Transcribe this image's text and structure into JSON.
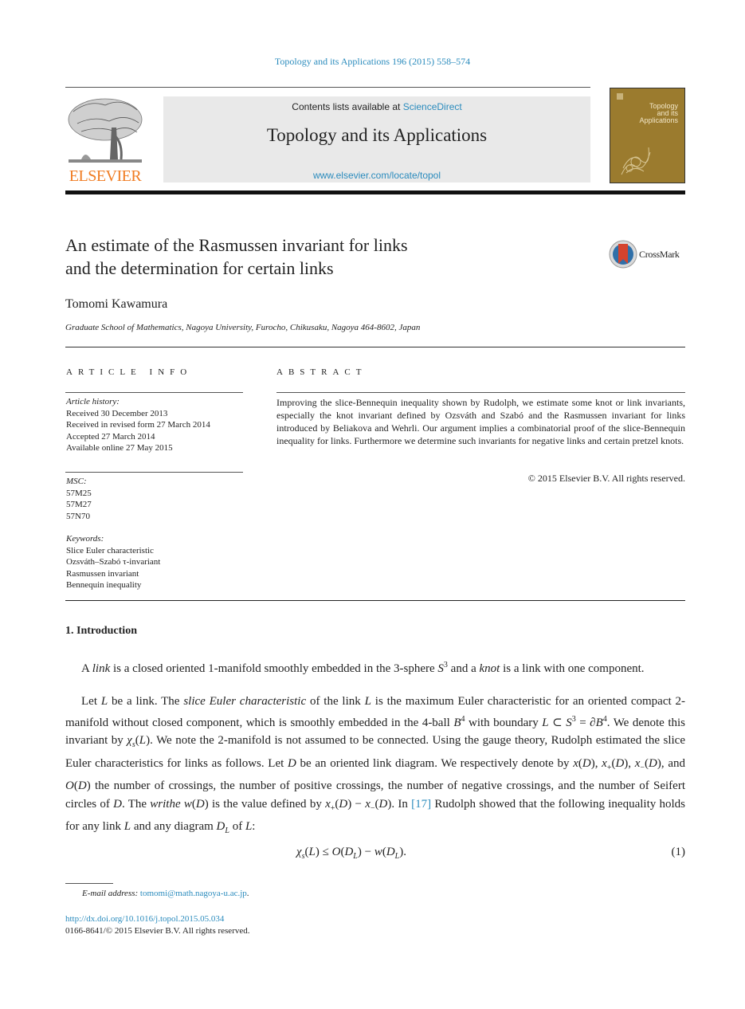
{
  "header": {
    "journal_ref": "Topology and its Applications 196 (2015) 558–574",
    "contents_prefix": "Contents lists available at ",
    "contents_link": "ScienceDirect",
    "journal_title": "Topology and its Applications",
    "journal_url": "www.elsevier.com/locate/topol",
    "publisher_logo_text": "ELSEVIER",
    "cover_title_lines": [
      "Topology",
      "and its",
      "Applications"
    ]
  },
  "colors": {
    "link": "#2a8bbd",
    "elsevier_orange": "#f07c22",
    "cover_gold": "#9b7b2e",
    "masthead_gray": "#e9e9e9"
  },
  "article": {
    "title_lines": [
      "An estimate of the Rasmussen invariant for links",
      "and the determination for certain links"
    ],
    "crossmark_label": "CrossMark",
    "author": "Tomomi Kawamura",
    "affiliation": "Graduate School of Mathematics, Nagoya University, Furocho, Chikusaku, Nagoya 464-8602, Japan"
  },
  "article_info": {
    "heading": "ARTICLE INFO",
    "history_label": "Article history:",
    "history": [
      "Received 30 December 2013",
      "Received in revised form 27 March 2014",
      "Accepted 27 March 2014",
      "Available online 27 May 2015"
    ],
    "msc_label": "MSC:",
    "msc": [
      "57M25",
      "57M27",
      "57N70"
    ],
    "keywords_label": "Keywords:",
    "keywords": [
      "Slice Euler characteristic",
      "Ozsváth–Szabó τ-invariant",
      "Rasmussen invariant",
      "Bennequin inequality"
    ]
  },
  "abstract": {
    "heading": "ABSTRACT",
    "text": "Improving the slice-Bennequin inequality shown by Rudolph, we estimate some knot or link invariants, especially the knot invariant defined by Ozsváth and Szabó and the Rasmussen invariant for links introduced by Beliakova and Wehrli. Our argument implies a combinatorial proof of the slice-Bennequin inequality for links. Furthermore we determine such invariants for negative links and certain pretzel knots.",
    "copyright": "© 2015 Elsevier B.V. All rights reserved."
  },
  "body": {
    "section_heading": "1. Introduction",
    "para1": {
      "t1": "A ",
      "i1": "link",
      "t2": " is a closed oriented 1-manifold smoothly embedded in the 3-sphere ",
      "m1": "S",
      "m1sup": "3",
      "t3": " and a ",
      "i2": "knot",
      "t4": " is a link with one component."
    },
    "para2": {
      "t1": "Let ",
      "t2": " be a link. The ",
      "i1": "slice Euler characteristic",
      "t3": " of the link ",
      "t4": " is the maximum Euler characteristic for an oriented compact 2-manifold without closed component, which is smoothly embedded in the 4-ball ",
      "t5": " with boundary ",
      "t6": ". We denote this invariant by ",
      "t7": ". We note the 2-manifold is not assumed to be connected. Using the gauge theory, Rudolph estimated the slice Euler characteristics for links as follows. Let ",
      "t8": " be an oriented link diagram. We respectively denote by ",
      "t9": ", and ",
      "t10": " the number of crossings, the number of positive crossings, the number of negative crossings, and the number of Seifert circles of ",
      "t11": ". The ",
      "i2": "writhe",
      "t12": " is the value defined by ",
      "t13": ". In ",
      "ref": "[17]",
      "t14": " Rudolph showed that the following inequality holds for any link ",
      "t15": " and any diagram ",
      "t16": " of "
    },
    "equation_number": "(1)"
  },
  "footer": {
    "email_label": "E-mail address:",
    "email": "tomomi@math.nagoya-u.ac.jp",
    "doi": "http://dx.doi.org/10.1016/j.topol.2015.05.034",
    "issn": "0166-8641/© 2015 Elsevier B.V. All rights reserved."
  }
}
